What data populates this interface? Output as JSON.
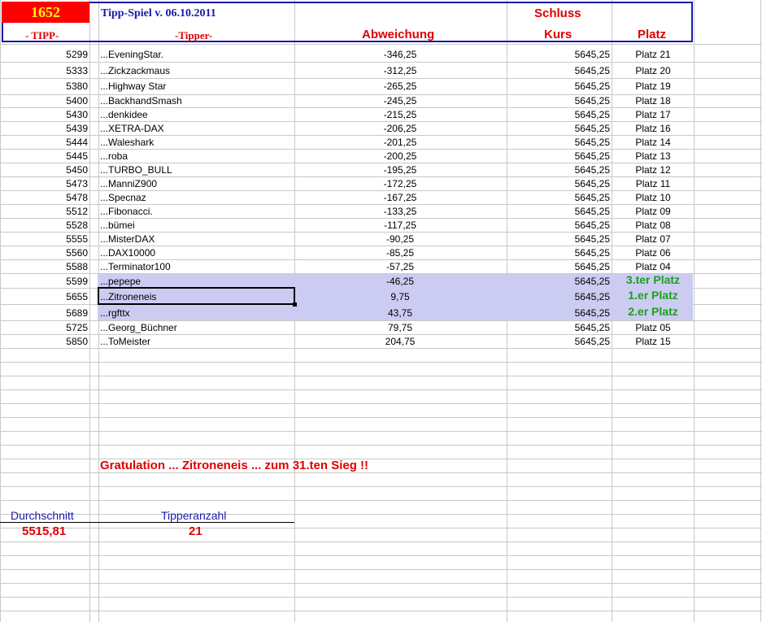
{
  "header": {
    "tipp_number": "1652",
    "game_title": "Tipp-Spiel v. 06.10.2011",
    "schluss_label": "Schluss",
    "col_tipp": "- TIPP-",
    "col_tipper": "-Tipper-",
    "col_abweichung": "Abweichung",
    "col_kurs": "Kurs",
    "col_platz": "Platz"
  },
  "rows": [
    {
      "tipp": "5299",
      "tipper": "...EveningStar.",
      "abw": "-346,25",
      "kurs": "5645,25",
      "platz": "Platz 21"
    },
    {
      "tipp": "5333",
      "tipper": "...Zickzackmaus",
      "abw": "-312,25",
      "kurs": "5645,25",
      "platz": "Platz 20"
    },
    {
      "tipp": "5380",
      "tipper": "...Highway Star",
      "abw": "-265,25",
      "kurs": "5645,25",
      "platz": "Platz 19"
    },
    {
      "tipp": "5400",
      "tipper": "...BackhandSmash",
      "abw": "-245,25",
      "kurs": "5645,25",
      "platz": "Platz 18"
    },
    {
      "tipp": "5430",
      "tipper": "...denkidee",
      "abw": "-215,25",
      "kurs": "5645,25",
      "platz": "Platz 17"
    },
    {
      "tipp": "5439",
      "tipper": "...XETRA-DAX",
      "abw": "-206,25",
      "kurs": "5645,25",
      "platz": "Platz 16"
    },
    {
      "tipp": "5444",
      "tipper": "...Waleshark",
      "abw": "-201,25",
      "kurs": "5645,25",
      "platz": "Platz 14"
    },
    {
      "tipp": "5445",
      "tipper": "...roba",
      "abw": "-200,25",
      "kurs": "5645,25",
      "platz": "Platz 13"
    },
    {
      "tipp": "5450",
      "tipper": "...TURBO_BULL",
      "abw": "-195,25",
      "kurs": "5645,25",
      "platz": "Platz 12"
    },
    {
      "tipp": "5473",
      "tipper": "...ManniZ900",
      "abw": "-172,25",
      "kurs": "5645,25",
      "platz": "Platz 11"
    },
    {
      "tipp": "5478",
      "tipper": "...Specnaz",
      "abw": "-167,25",
      "kurs": "5645,25",
      "platz": "Platz 10"
    },
    {
      "tipp": "5512",
      "tipper": "...Fibonacci.",
      "abw": "-133,25",
      "kurs": "5645,25",
      "platz": "Platz 09"
    },
    {
      "tipp": "5528",
      "tipper": "...bümei",
      "abw": "-117,25",
      "kurs": "5645,25",
      "platz": "Platz 08"
    },
    {
      "tipp": "5555",
      "tipper": "...MisterDAX",
      "abw": "-90,25",
      "kurs": "5645,25",
      "platz": "Platz 07"
    },
    {
      "tipp": "5560",
      "tipper": "...DAX10000",
      "abw": "-85,25",
      "kurs": "5645,25",
      "platz": "Platz 06"
    },
    {
      "tipp": "5588",
      "tipper": "...Terminator100",
      "abw": "-57,25",
      "kurs": "5645,25",
      "platz": "Platz 04"
    },
    {
      "tipp": "5599",
      "tipper": "...pepepe",
      "abw": "-46,25",
      "kurs": "5645,25",
      "platz": "3.ter Platz"
    },
    {
      "tipp": "5655",
      "tipper": "...Zitroneneis",
      "abw": "9,75",
      "kurs": "5645,25",
      "platz": "1.er Platz"
    },
    {
      "tipp": "5689",
      "tipper": "...rgfttx",
      "abw": "43,75",
      "kurs": "5645,25",
      "platz": "2.er Platz"
    },
    {
      "tipp": "5725",
      "tipper": "...Georg_Büchner",
      "abw": "79,75",
      "kurs": "5645,25",
      "platz": "Platz 05"
    },
    {
      "tipp": "5850",
      "tipper": "...ToMeister",
      "abw": "204,75",
      "kurs": "5645,25",
      "platz": "Platz 15"
    }
  ],
  "congrats": "Gratulation   ... Zitroneneis ... zum   31.ten Sieg !!",
  "stats": {
    "avg_label": "Durchschnitt",
    "avg_value": "5515,81",
    "count_label": "Tipperanzahl",
    "count_value": "21"
  },
  "colors": {
    "title_blue": "#1a1aa8",
    "accent_red": "#e00000",
    "podium_green": "#1aa01a",
    "highlight": "#ccccf2"
  }
}
